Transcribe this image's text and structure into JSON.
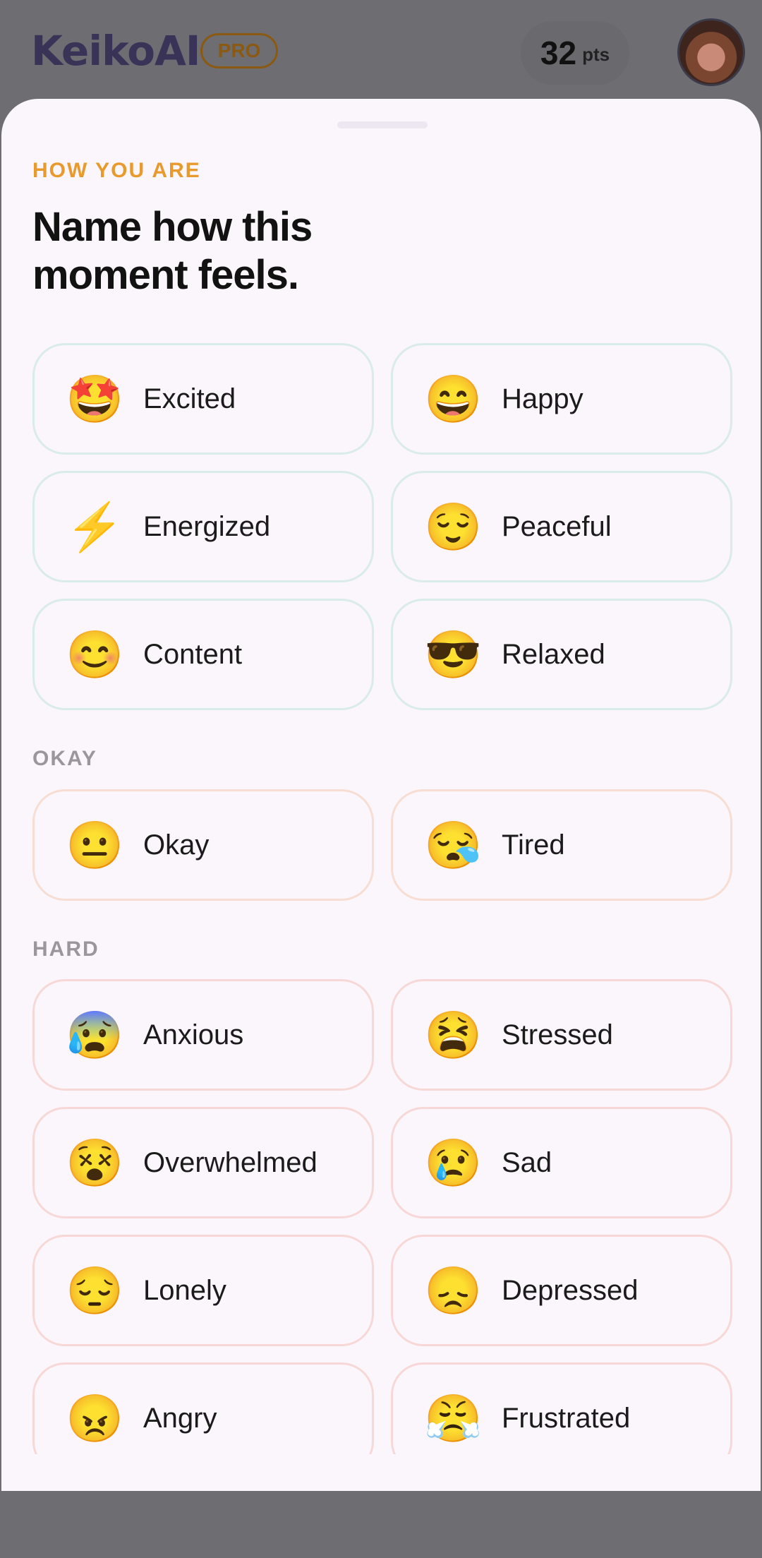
{
  "header": {
    "app_name": "KeikoAI",
    "badge": "PRO",
    "points_value": "32",
    "points_unit": "pts"
  },
  "sheet": {
    "eyebrow": "HOW YOU ARE",
    "title": "Name how this moment feels.",
    "sections": [
      {
        "label": ""
      },
      {
        "label": "OKAY"
      },
      {
        "label": "HARD"
      }
    ],
    "moods": [
      {
        "label": "Excited",
        "emoji": "🤩",
        "icon": "star-struck-icon"
      },
      {
        "label": "Happy",
        "emoji": "😄",
        "icon": "grinning-face-icon"
      },
      {
        "label": "Energized",
        "emoji": "⚡",
        "icon": "lightning-icon"
      },
      {
        "label": "Peaceful",
        "emoji": "😌",
        "icon": "relieved-face-icon"
      },
      {
        "label": "Content",
        "emoji": "😊",
        "icon": "smiling-face-icon"
      },
      {
        "label": "Relaxed",
        "emoji": "😎",
        "icon": "sunglasses-face-icon"
      },
      {
        "label": "Okay",
        "emoji": "😐",
        "icon": "neutral-face-icon"
      },
      {
        "label": "Tired",
        "emoji": "😪",
        "icon": "sleepy-face-icon"
      },
      {
        "label": "Anxious",
        "emoji": "😰",
        "icon": "anxious-face-icon"
      },
      {
        "label": "Stressed",
        "emoji": "😫",
        "icon": "tired-face-icon"
      },
      {
        "label": "Overwhelmed",
        "emoji": "😵",
        "icon": "dizzy-face-icon"
      },
      {
        "label": "Sad",
        "emoji": "😢",
        "icon": "crying-face-icon"
      },
      {
        "label": "Lonely",
        "emoji": "😔",
        "icon": "pensive-face-icon"
      },
      {
        "label": "Depressed",
        "emoji": "😞",
        "icon": "disappointed-face-icon"
      },
      {
        "label": "Angry",
        "emoji": "😠",
        "icon": "angry-face-icon"
      },
      {
        "label": "Frustrated",
        "emoji": "😤",
        "icon": "steam-face-icon"
      }
    ]
  },
  "colors": {
    "accent": "#e89a2c",
    "sheet_bg": "#faf6fb",
    "overlay": "#6e6d72"
  }
}
